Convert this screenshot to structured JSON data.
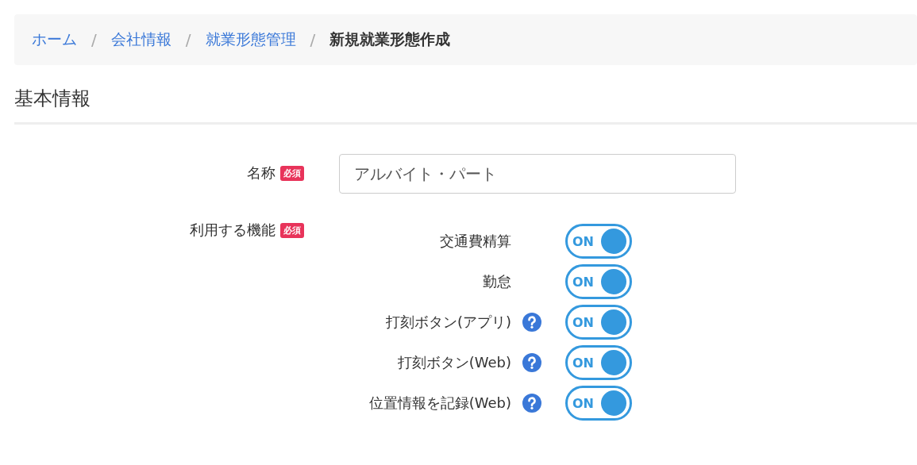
{
  "breadcrumb": [
    {
      "label": "ホーム",
      "current": false
    },
    {
      "label": "会社情報",
      "current": false
    },
    {
      "label": "就業形態管理",
      "current": false
    },
    {
      "label": "新規就業形態作成",
      "current": true
    }
  ],
  "breadcrumb_separator": "/",
  "section_title": "基本情報",
  "name_field": {
    "label": "名称",
    "required_badge": "必須",
    "value": "アルバイト・パート"
  },
  "features": {
    "label": "利用する機能",
    "required_badge": "必須",
    "items": [
      {
        "label": "交通費精算",
        "help": false,
        "on": true,
        "toggle_text": "ON"
      },
      {
        "label": "勤怠",
        "help": false,
        "on": true,
        "toggle_text": "ON"
      },
      {
        "label": "打刻ボタン(アプリ)",
        "help": true,
        "on": true,
        "toggle_text": "ON"
      },
      {
        "label": "打刻ボタン(Web)",
        "help": true,
        "on": true,
        "toggle_text": "ON"
      },
      {
        "label": "位置情報を記録(Web)",
        "help": true,
        "on": true,
        "toggle_text": "ON"
      }
    ]
  }
}
